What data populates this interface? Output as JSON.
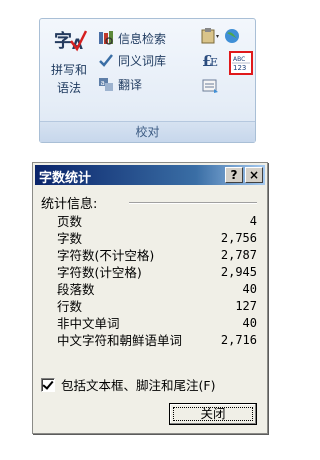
{
  "ribbon": {
    "group_label": "校对",
    "spelling": {
      "line1": "拼写和",
      "line2": "语法",
      "icon": "spelling-grammar-icon"
    },
    "research": {
      "label": "信息检索",
      "icon": "research-books-icon"
    },
    "thesaurus": {
      "label": "同义词库",
      "icon": "thesaurus-icon"
    },
    "translate": {
      "label": "翻译",
      "icon": "translate-icon"
    },
    "set_language": {
      "icon": "set-language-icon"
    },
    "word_count": {
      "icon": "word-count-icon",
      "icon_text_top": "ABC",
      "icon_text_bottom": "123",
      "highlight_color": "#e0191b"
    }
  },
  "dialog": {
    "title": "字数统计",
    "help_button": "?",
    "close_x": "×",
    "section_label": "统计信息:",
    "stats": [
      {
        "label": "页数",
        "value": "4"
      },
      {
        "label": "字数",
        "value": "2,756"
      },
      {
        "label": "字符数(不计空格)",
        "value": "2,787"
      },
      {
        "label": "字符数(计空格)",
        "value": "2,945"
      },
      {
        "label": "段落数",
        "value": "40"
      },
      {
        "label": "行数",
        "value": "127"
      },
      {
        "label": "非中文单词",
        "value": "40"
      },
      {
        "label": "中文字符和朝鲜语单词",
        "value": "2,716"
      }
    ],
    "checkbox_label": "包括文本框、脚注和尾注(F)",
    "checkbox_checked": true,
    "close_button": "关闭"
  }
}
